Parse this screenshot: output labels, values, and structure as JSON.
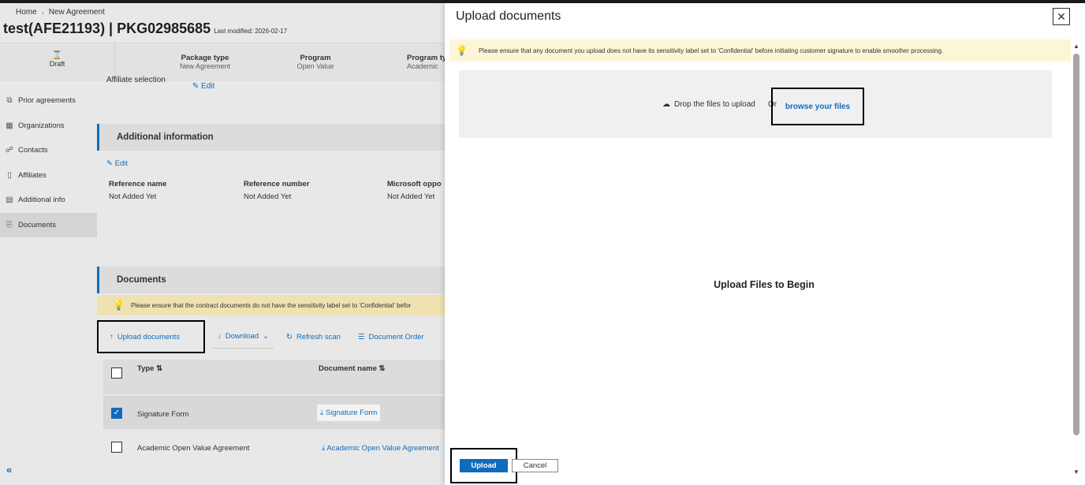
{
  "breadcrumb": {
    "home": "Home",
    "current": "New Agreement"
  },
  "page": {
    "title": "test(AFE21193) | PKG02985685",
    "last_modified": "Last modified: 2026-02-17"
  },
  "info_bar": {
    "status": "Draft",
    "package_type_label": "Package type",
    "package_type_value": "New Agreement",
    "program_label": "Program",
    "program_value": "Open Value",
    "program_type_label": "Program ty",
    "program_type_value": "Academic"
  },
  "sidebar": {
    "items": [
      {
        "label": "Prior agreements",
        "icon": "prior-agreements-icon"
      },
      {
        "label": "Organizations",
        "icon": "organizations-icon"
      },
      {
        "label": "Contacts",
        "icon": "contacts-icon"
      },
      {
        "label": "Affiliates",
        "icon": "affiliates-icon"
      },
      {
        "label": "Additional info",
        "icon": "additional-info-icon"
      },
      {
        "label": "Documents",
        "icon": "documents-icon"
      }
    ],
    "collapse": "«"
  },
  "content": {
    "affiliate_label": "Affiliate selection",
    "affiliate_edit": "Edit",
    "additional_info_title": "Additional information",
    "edit": "Edit",
    "ref_name_label": "Reference name",
    "ref_name_value": "Not Added Yet",
    "ref_number_label": "Reference number",
    "ref_number_value": "Not Added Yet",
    "ms_oppo_label": "Microsoft oppo",
    "ms_oppo_value": "Not Added Yet",
    "documents_title": "Documents",
    "doc_warning": "Please ensure that the contract documents do not have the sensitivity label set to 'Confidential' befor",
    "toolbar": {
      "upload": "Upload documents",
      "download": "Download",
      "refresh": "Refresh scan",
      "order": "Document Order"
    },
    "table": {
      "col_type": "Type ⇅",
      "col_name": "Document name ⇅",
      "rows": [
        {
          "type": "Signature Form",
          "name": "Signature Form",
          "checked": true
        },
        {
          "type": "Academic Open Value Agreement",
          "name": "Academic Open Value Agreement",
          "checked": false
        }
      ]
    }
  },
  "panel": {
    "title": "Upload documents",
    "close": "✕",
    "warning": "Please ensure that any document you upload does not have its sensitivity label set to 'Confidential' before initiating customer signature to enable smoother processing.",
    "drop_text": "Drop the files to upload",
    "or_text": "Or",
    "browse": "browse your files",
    "empty_message": "Upload Files to Begin",
    "upload_btn": "Upload",
    "cancel_btn": "Cancel"
  },
  "colors": {
    "accent": "#0f6cbd",
    "warning_bg": "#fdf6d6"
  }
}
